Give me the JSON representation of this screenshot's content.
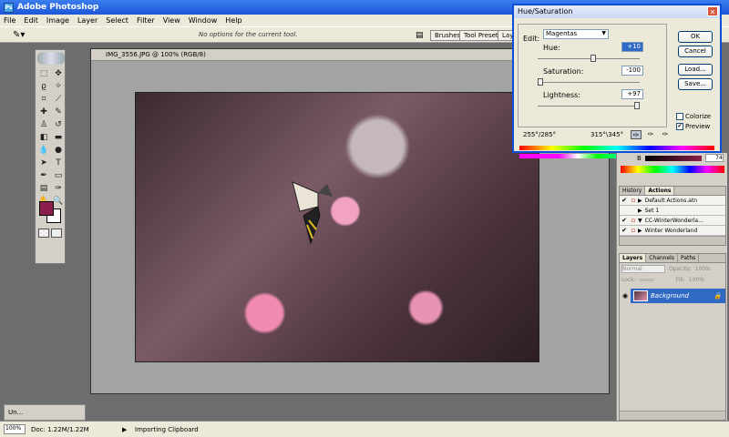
{
  "app": {
    "title": "Adobe Photoshop",
    "icon": "photoshop-icon"
  },
  "menu": [
    "File",
    "Edit",
    "Image",
    "Layer",
    "Select",
    "Filter",
    "View",
    "Window",
    "Help"
  ],
  "options_bar": {
    "hint": "No options for the current tool.",
    "palette_tabs": [
      "Brushes",
      "Tool Presets",
      "Layer Comps"
    ]
  },
  "document": {
    "title": "IMG_3556.JPG @ 100% (RGB/8)"
  },
  "hue_saturation": {
    "title": "Hue/Saturation",
    "edit_label": "Edit:",
    "edit_value": "Magentas",
    "hue_label": "Hue:",
    "hue_value": "+10",
    "saturation_label": "Saturation:",
    "saturation_value": "-100",
    "lightness_label": "Lightness:",
    "lightness_value": "+97",
    "buttons": {
      "ok": "OK",
      "cancel": "Cancel",
      "load": "Load...",
      "save": "Save..."
    },
    "colorize_label": "Colorize",
    "preview_label": "Preview",
    "range_left": "255°/285°",
    "range_right": "315°\\345°"
  },
  "color_panel": {
    "channel": "B",
    "value": "74"
  },
  "actions_panel": {
    "tabs": [
      "History",
      "Actions"
    ],
    "rows": [
      {
        "label": "Default Actions.atn",
        "checked": "✔",
        "expand": "▶"
      },
      {
        "label": "Set 1",
        "checked": "",
        "expand": "▶"
      },
      {
        "label": "CC-WinterWonderla...",
        "checked": "✔",
        "expand": "▼"
      },
      {
        "label": "Winter Wonderland",
        "checked": "✔",
        "expand": "▶"
      }
    ]
  },
  "layers_panel": {
    "tabs": [
      "Layers",
      "Channels",
      "Paths"
    ],
    "blend_mode": "Normal",
    "opacity_label": "Opacity:",
    "opacity_value": "100%",
    "lock_label": "Lock:",
    "fill_label": "Fill:",
    "fill_value": "100%",
    "layer_name": "Background"
  },
  "minimized": {
    "label": "Un..."
  },
  "status": {
    "zoom": "100%",
    "doc_size": "Doc: 1.22M/1.22M",
    "message": "Importing Clipboard"
  },
  "colors": {
    "foreground": "#8b1e4a",
    "background": "#ffffff",
    "selection": "#316ac5"
  }
}
